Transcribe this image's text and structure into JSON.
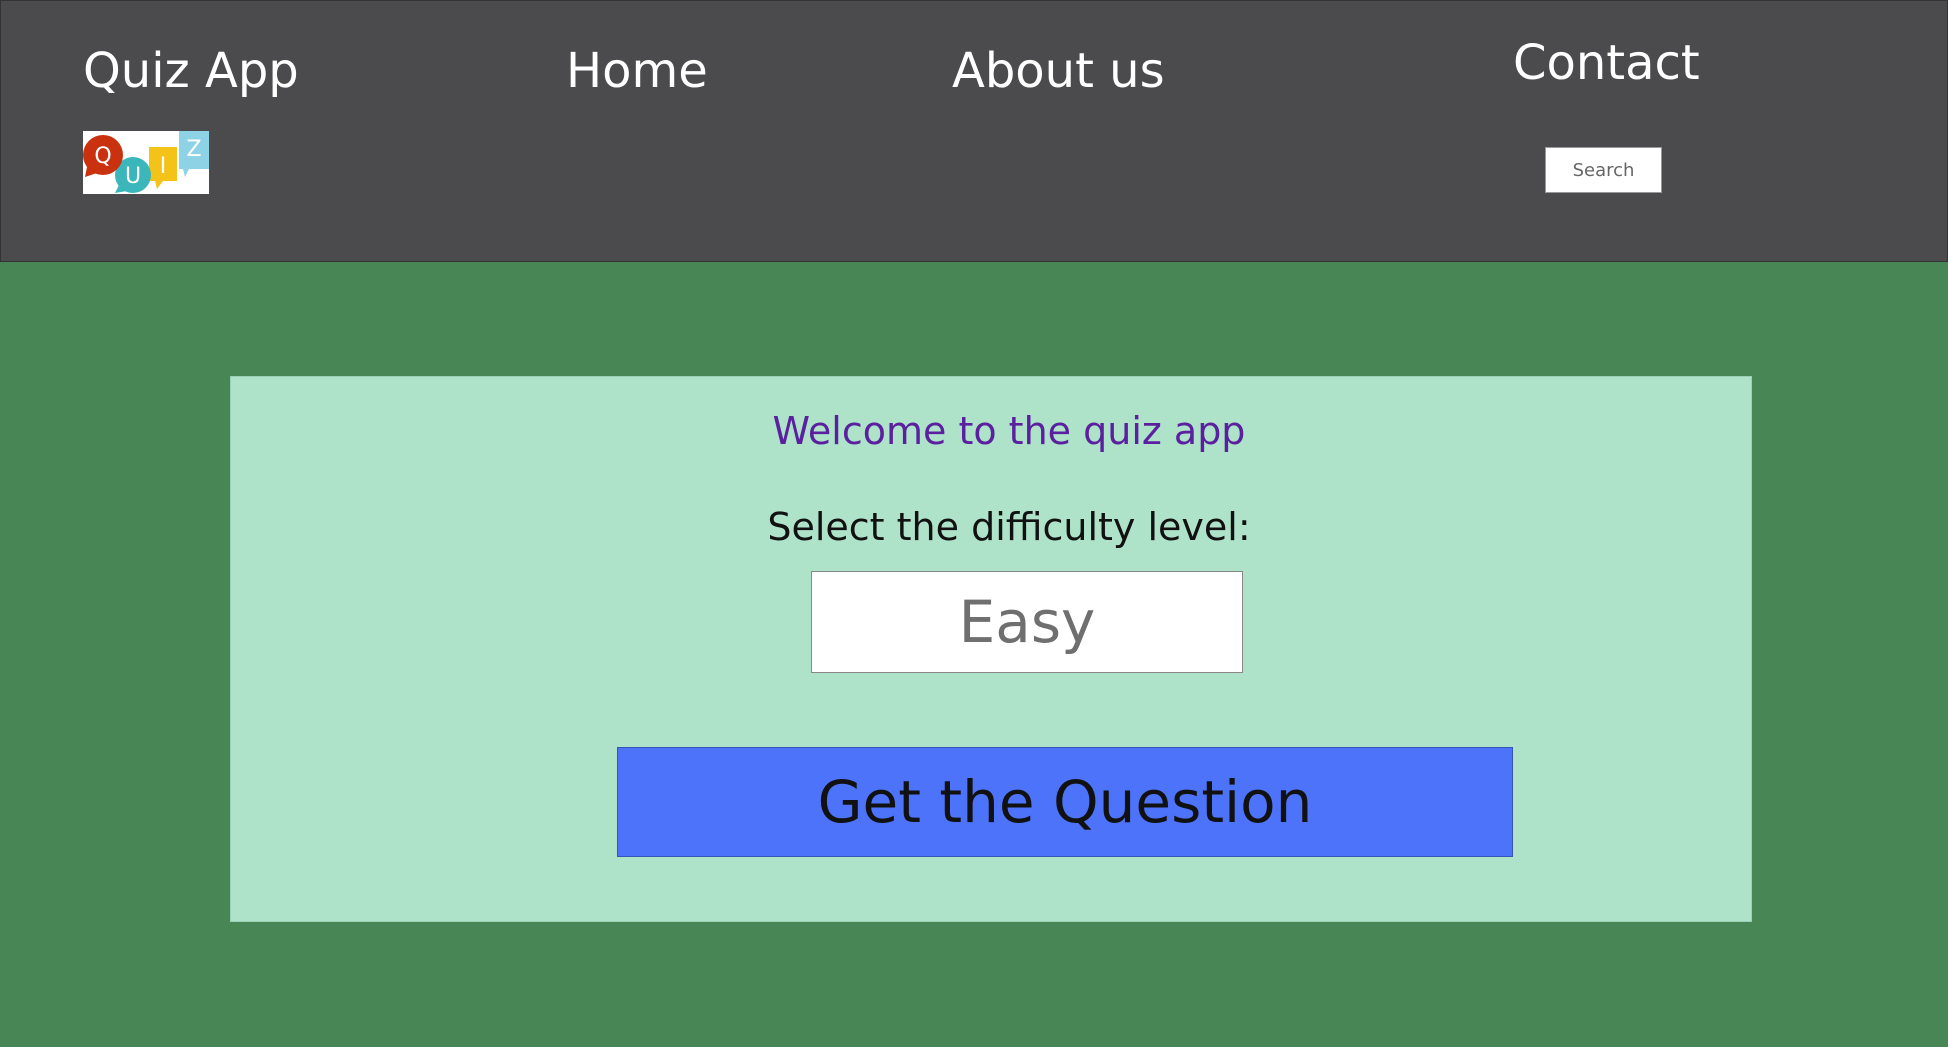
{
  "header": {
    "brand": "Quiz App",
    "nav": {
      "home": "Home",
      "about": "About us",
      "contact": "Contact"
    },
    "logo": {
      "letters": [
        "Q",
        "U",
        "I",
        "Z"
      ],
      "colors": [
        "#c9310f",
        "#3bb7bc",
        "#f4c31a",
        "#8ed3e5"
      ]
    },
    "search": {
      "placeholder": "Search"
    }
  },
  "main": {
    "welcome": "Welcome to the quiz app",
    "difficulty_label": "Select the difficulty level:",
    "difficulty_value": "Easy",
    "get_question_label": "Get the Question"
  },
  "colors": {
    "header_bg": "#4b4a4c",
    "page_bg": "#488656",
    "card_bg": "#aee3ca",
    "welcome_text": "#5b20a0",
    "button_bg": "#4e73fb"
  }
}
